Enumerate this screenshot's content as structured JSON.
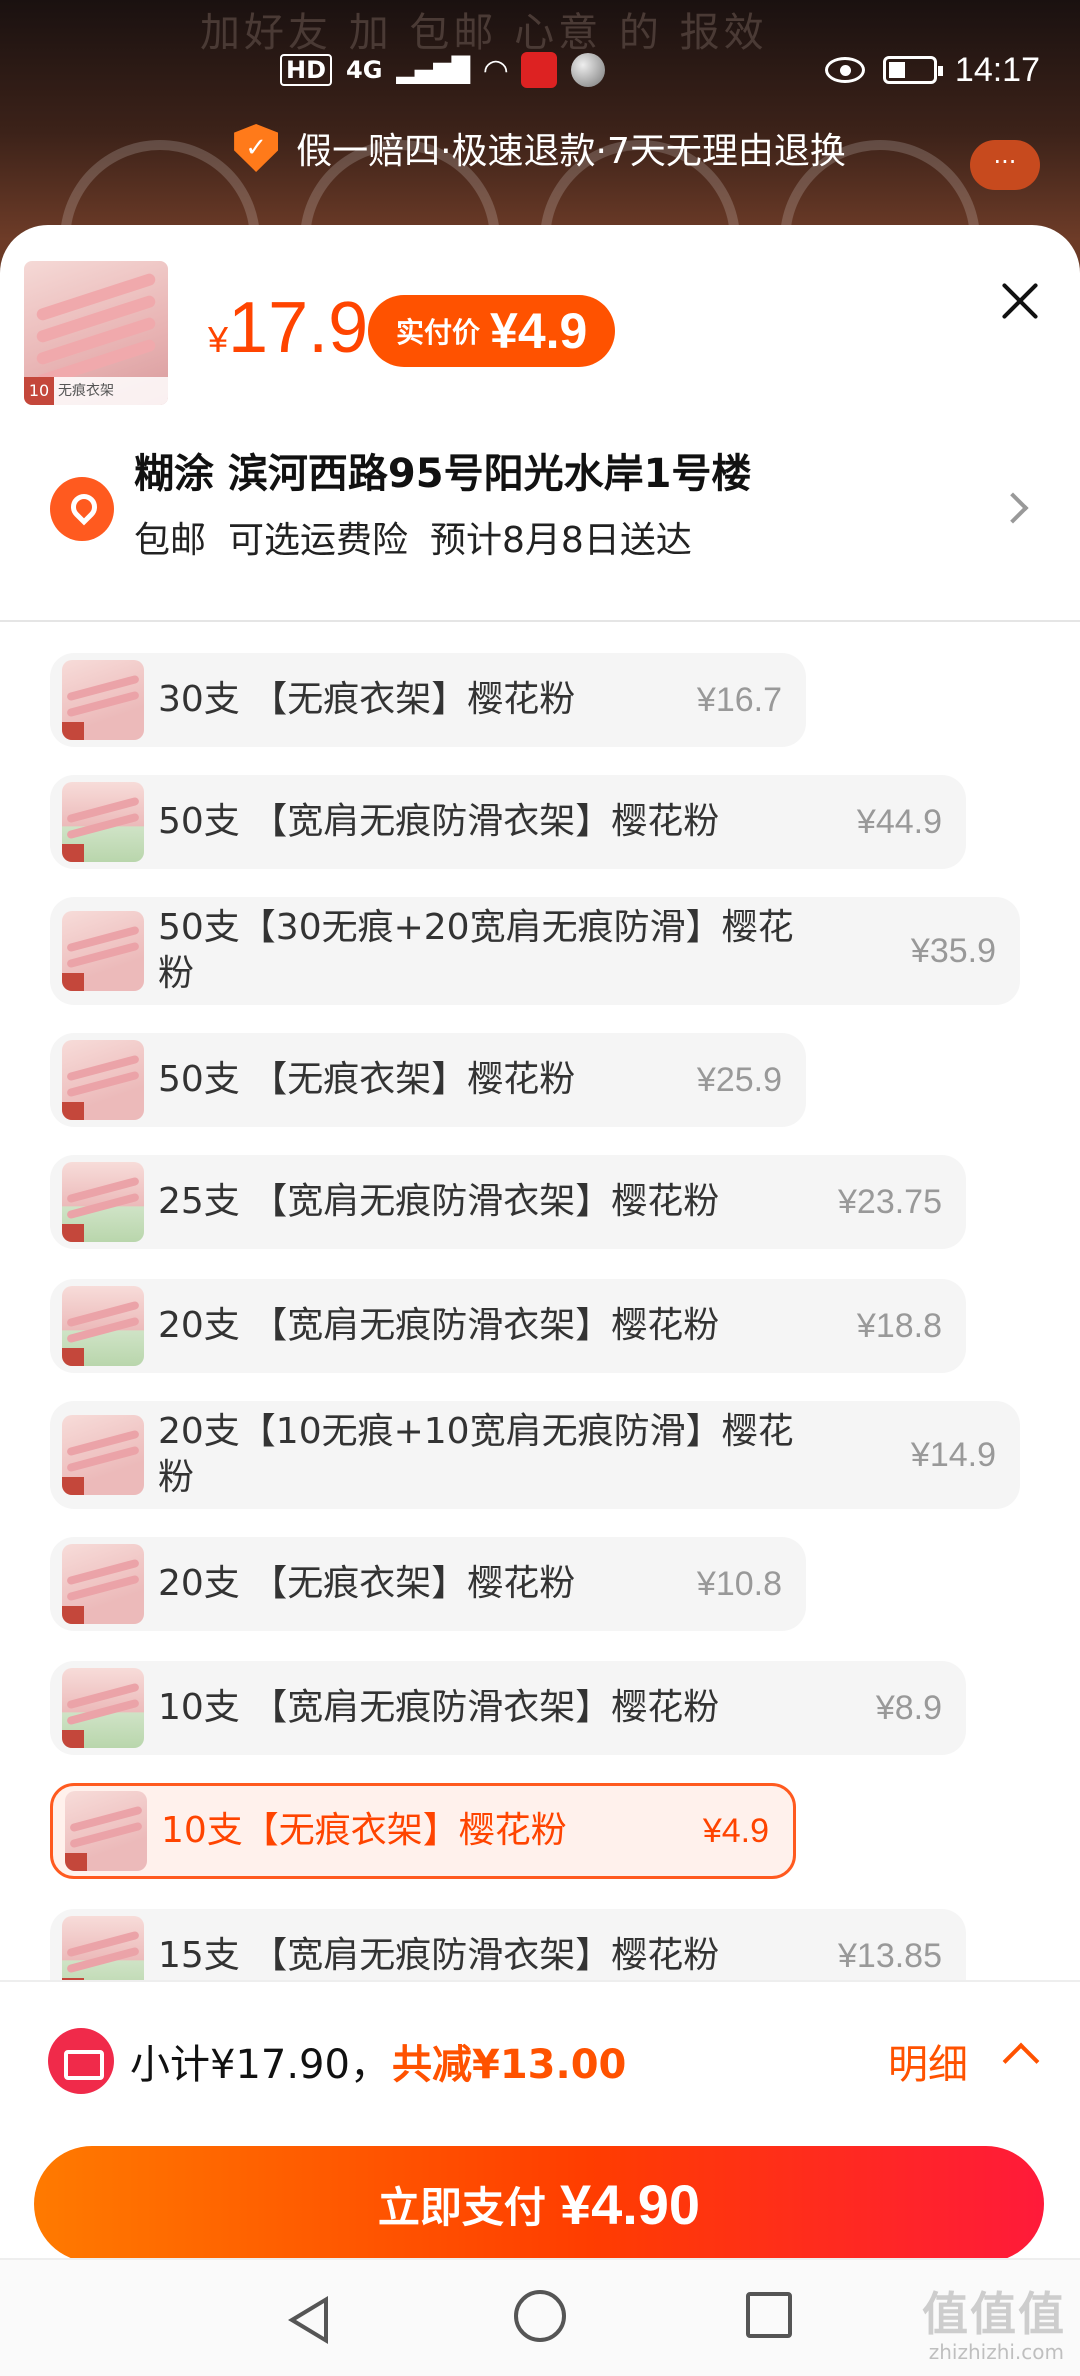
{
  "status_bar": {
    "network": "4G",
    "hd": "HD",
    "time": "14:17"
  },
  "background": {
    "hint_text": "加好友 加 包邮 心意 的 报效"
  },
  "guarantee": {
    "shield_glyph": "✓",
    "text": "假一赔四·极速退款·7天无理由退换"
  },
  "header": {
    "thumb_tag": "无痕衣架",
    "thumb_num": "10",
    "price_symbol": "¥",
    "price_value": "17.9",
    "pay_label": "实付价",
    "pay_amount": "¥4.9"
  },
  "address": {
    "line": "糊涂 滨河西路95号阳光水岸1号楼",
    "shipping": [
      "包邮",
      "可选运费险",
      "预计8月8日送达"
    ]
  },
  "sku_options": [
    {
      "name": "30支 【无痕衣架】樱花粉",
      "price": "¥16.7",
      "selected": false
    },
    {
      "name": "50支 【宽肩无痕防滑衣架】樱花粉",
      "price": "¥44.9",
      "selected": false
    },
    {
      "name": "50支【30无痕+20宽肩无痕防滑】樱花粉",
      "price": "¥35.9",
      "selected": false
    },
    {
      "name": "50支 【无痕衣架】樱花粉",
      "price": "¥25.9",
      "selected": false
    },
    {
      "name": "25支 【宽肩无痕防滑衣架】樱花粉",
      "price": "¥23.75",
      "selected": false
    },
    {
      "name": "20支 【宽肩无痕防滑衣架】樱花粉",
      "price": "¥18.8",
      "selected": false
    },
    {
      "name": "20支【10无痕+10宽肩无痕防滑】樱花粉",
      "price": "¥14.9",
      "selected": false
    },
    {
      "name": "20支 【无痕衣架】樱花粉",
      "price": "¥10.8",
      "selected": false
    },
    {
      "name": "10支 【宽肩无痕防滑衣架】樱花粉",
      "price": "¥8.9",
      "selected": false
    },
    {
      "name": "10支【无痕衣架】樱花粉",
      "price": "¥4.9",
      "selected": true
    },
    {
      "name": "15支 【宽肩无痕防滑衣架】樱花粉",
      "price": "¥13.85",
      "selected": false
    }
  ],
  "footer": {
    "subtotal": "小计¥17.90，",
    "discount": "共减¥13.00",
    "detail_label": "明细",
    "pay_label": "立即支付",
    "pay_amount": "¥4.90"
  },
  "watermark": {
    "main": "值值值",
    "sub": "zhizhizhi.com"
  },
  "colors": {
    "accent": "#ff5200",
    "price_red": "#ff4400",
    "selected_bg": "#fff1ec"
  }
}
